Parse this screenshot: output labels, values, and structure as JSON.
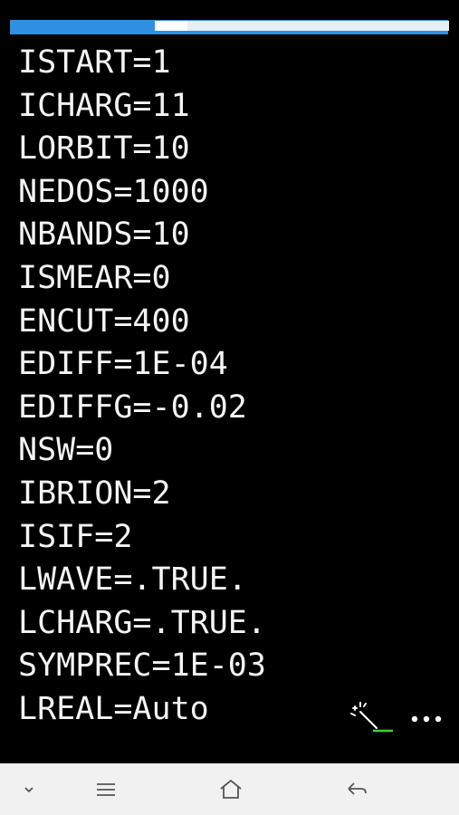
{
  "terminal": {
    "lines": [
      "ISTART=1",
      "ICHARG=11",
      "LORBIT=10",
      "NEDOS=1000",
      "NBANDS=10",
      "ISMEAR=0",
      "ENCUT=400",
      "EDIFF=1E-04",
      "EDIFFG=-0.02",
      "NSW=0",
      "IBRION=2",
      "ISIF=2",
      "LWAVE=.TRUE.",
      "LCHARG=.TRUE.",
      "SYMPREC=1E-03",
      "LREAL=Auto"
    ],
    "text_color": "#f4f4f4",
    "background": "#000000"
  },
  "tab_bar": {
    "accent": "#2f8fe0"
  },
  "toolbar": {
    "icons": [
      "magic-wand-icon",
      "more-options-icon"
    ]
  },
  "nav_bar": {
    "icons": [
      "chevron-down-icon",
      "menu-icon",
      "home-icon",
      "back-icon"
    ],
    "background": "#f1f1f1"
  }
}
